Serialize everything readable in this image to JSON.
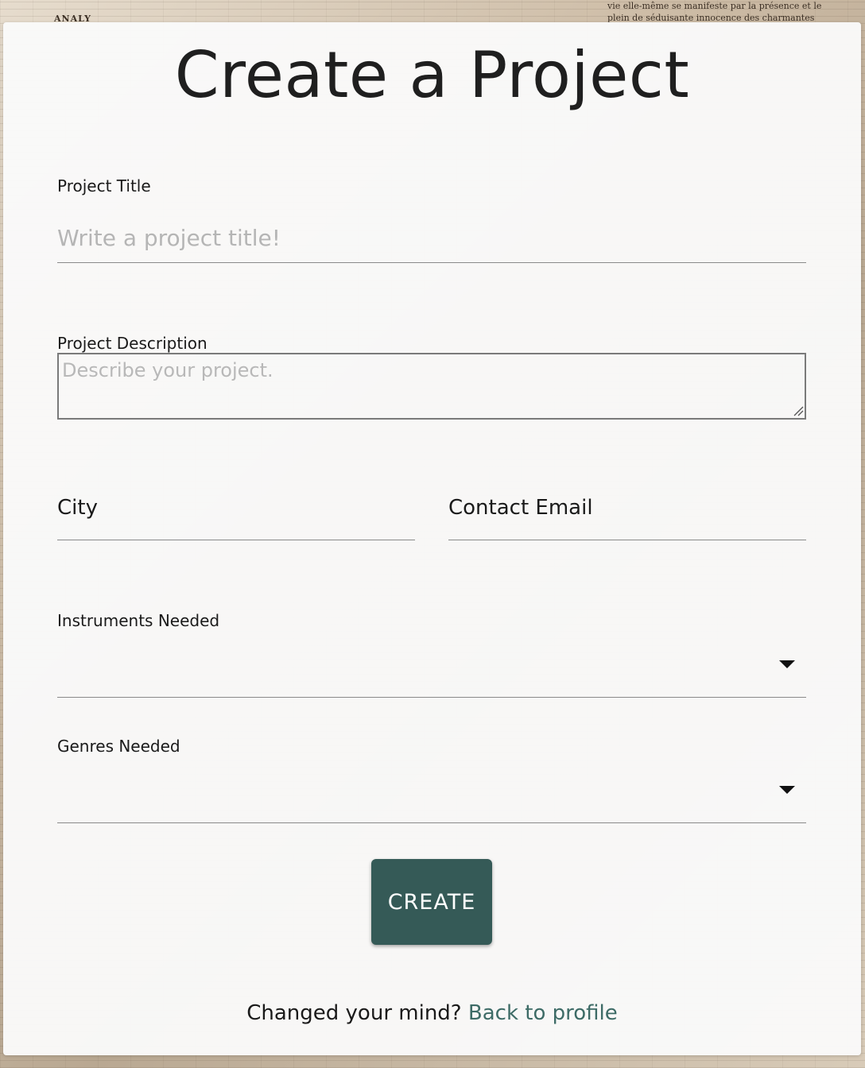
{
  "background": {
    "top_right_text": "vie elle-même se manifeste par la présence et le plein de séduisante innocence des charmantes",
    "top_left_text": "ANALY"
  },
  "page": {
    "title": "Create a Project"
  },
  "form": {
    "project_title": {
      "label": "Project Title",
      "placeholder": "Write a project title!",
      "value": ""
    },
    "project_description": {
      "label": "Project Description",
      "placeholder": "Describe your project.",
      "value": ""
    },
    "city": {
      "label": "City",
      "value": ""
    },
    "contact_email": {
      "label": "Contact Email",
      "value": ""
    },
    "instruments_needed": {
      "label": "Instruments Needed",
      "selected": "",
      "icon": "caret-down-icon"
    },
    "genres_needed": {
      "label": "Genres Needed",
      "selected": "",
      "icon": "caret-down-icon"
    },
    "create_button": {
      "label": "CREATE"
    }
  },
  "footer": {
    "prompt": "Changed your mind?",
    "link_label": "Back to profile"
  },
  "colors": {
    "button_bg": "#355a57",
    "link": "#3d6b66",
    "card_bg": "#fafafa"
  }
}
